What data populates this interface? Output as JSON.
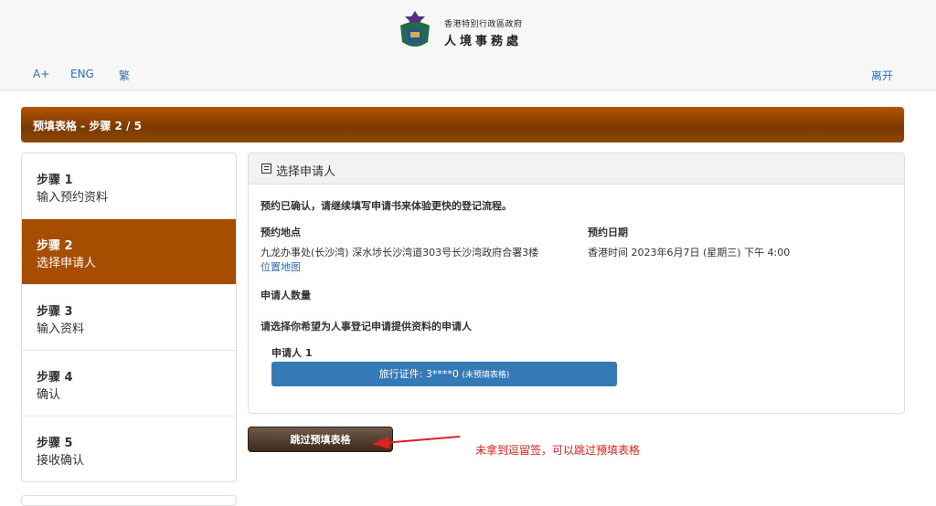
{
  "header": {
    "dept_line1": "香港特別行政區政府",
    "dept_line2": "人境事務處",
    "links": [
      "A+",
      "ENG",
      "繁"
    ],
    "exit": "离开"
  },
  "banner": {
    "title": "预填表格 - 步骤 2 / 5"
  },
  "steps": [
    {
      "title": "步骤 1",
      "subtitle": "输入预约资料"
    },
    {
      "title": "步骤 2",
      "subtitle": "选择申请人"
    },
    {
      "title": "步骤 3",
      "subtitle": "输入资料"
    },
    {
      "title": "步骤 4",
      "subtitle": "确认"
    },
    {
      "title": "步骤 5",
      "subtitle": "接收确认"
    }
  ],
  "panel": {
    "title": "选择申请人",
    "intro": "预约已确认，请继续填写申请书来体验更快的登记流程。",
    "location_label": "预约地点",
    "location_value": "九龙办事处(长沙湾) 深水埗长沙湾道303号长沙湾政府合署3楼",
    "map_link": "位置地图",
    "date_label": "预约日期",
    "date_value": "香港时间 2023年6月7日 (星期三) 下午 4:00",
    "applicant_count_label": "申请人数量",
    "choose_label": "请选择你希望为人事登记申请提供资料的申请人",
    "applicant_label": "申请人 1",
    "doc_button": "旅行证件: 3****0",
    "doc_button_note": "(未预填表格)"
  },
  "skip_button": "跳过预填表格",
  "annotation": "未拿到逗留签，可以跳过预填表格",
  "colors": {
    "active_step": "#a64d00",
    "banner": "#8e4700",
    "primary_button": "#337ab7",
    "annotation": "#e02020"
  }
}
